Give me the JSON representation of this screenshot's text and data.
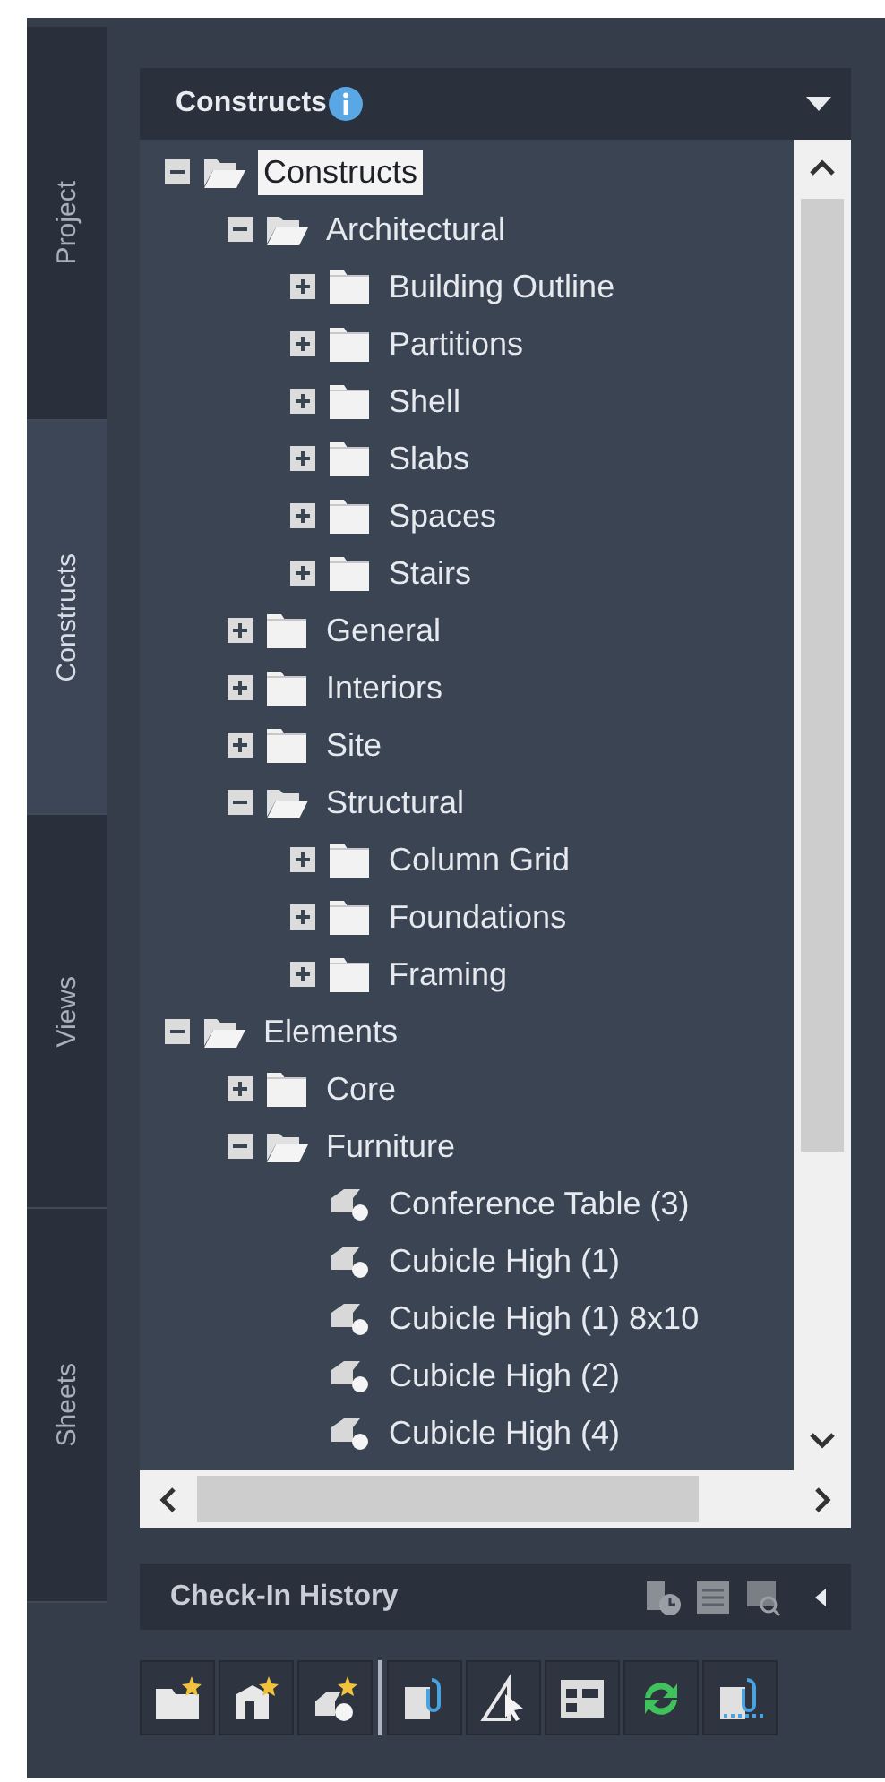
{
  "tabs": [
    {
      "label": "Project",
      "selected": false
    },
    {
      "label": "Constructs",
      "selected": true
    },
    {
      "label": "Views",
      "selected": false
    },
    {
      "label": "Sheets",
      "selected": false
    }
  ],
  "panel": {
    "title": "Constructs"
  },
  "tree": [
    {
      "label": "Constructs",
      "kind": "folder",
      "expanded": true,
      "selected": true,
      "children": [
        {
          "label": "Architectural",
          "kind": "folder",
          "expanded": true,
          "selected": false,
          "children": [
            {
              "label": "Building Outline",
              "kind": "folder",
              "expanded": false,
              "selected": false
            },
            {
              "label": "Partitions",
              "kind": "folder",
              "expanded": false,
              "selected": false
            },
            {
              "label": "Shell",
              "kind": "folder",
              "expanded": false,
              "selected": false
            },
            {
              "label": "Slabs",
              "kind": "folder",
              "expanded": false,
              "selected": false
            },
            {
              "label": "Spaces",
              "kind": "folder",
              "expanded": false,
              "selected": false
            },
            {
              "label": "Stairs",
              "kind": "folder",
              "expanded": false,
              "selected": false
            }
          ]
        },
        {
          "label": "General",
          "kind": "folder",
          "expanded": false,
          "selected": false
        },
        {
          "label": "Interiors",
          "kind": "folder",
          "expanded": false,
          "selected": false
        },
        {
          "label": "Site",
          "kind": "folder",
          "expanded": false,
          "selected": false
        },
        {
          "label": "Structural",
          "kind": "folder",
          "expanded": true,
          "selected": false,
          "children": [
            {
              "label": "Column Grid",
              "kind": "folder",
              "expanded": false,
              "selected": false
            },
            {
              "label": "Foundations",
              "kind": "folder",
              "expanded": false,
              "selected": false
            },
            {
              "label": "Framing",
              "kind": "folder",
              "expanded": false,
              "selected": false
            }
          ]
        }
      ]
    },
    {
      "label": "Elements",
      "kind": "folder",
      "expanded": true,
      "selected": false,
      "children": [
        {
          "label": "Core",
          "kind": "folder",
          "expanded": false,
          "selected": false
        },
        {
          "label": "Furniture",
          "kind": "folder",
          "expanded": true,
          "selected": false,
          "children": [
            {
              "label": "Conference Table (3)",
              "kind": "item",
              "selected": false
            },
            {
              "label": "Cubicle High (1)",
              "kind": "item",
              "selected": false
            },
            {
              "label": "Cubicle High (1) 8x10",
              "kind": "item",
              "selected": false
            },
            {
              "label": "Cubicle High (2)",
              "kind": "item",
              "selected": false
            },
            {
              "label": "Cubicle High (4)",
              "kind": "item",
              "selected": false
            }
          ]
        }
      ]
    }
  ],
  "check_in_history": {
    "title": "Check-In History"
  }
}
